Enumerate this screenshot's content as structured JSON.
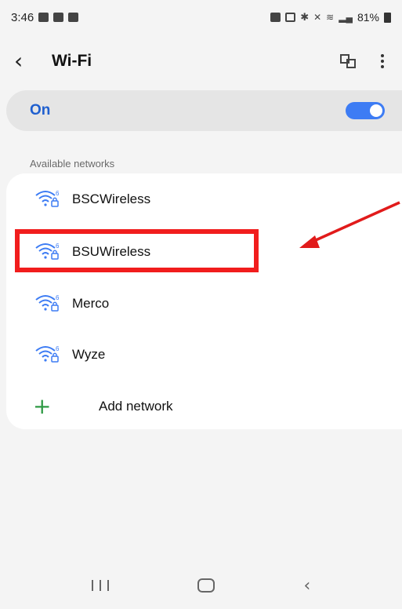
{
  "status_bar": {
    "time": "3:46",
    "battery": "81%",
    "left_icons": [
      "app-b-icon",
      "mail-icon",
      "gallery-icon"
    ],
    "right_icons": [
      "nfc-lock-icon",
      "nfc-icon",
      "bluetooth-icon",
      "mute-icon",
      "wifi-6-status-icon",
      "signal-icon",
      "battery-icon"
    ]
  },
  "app_bar": {
    "title": "Wi-Fi",
    "back_icon": "chevron-left-icon",
    "qr_icon": "qr-scan-icon",
    "more_icon": "more-vertical-icon"
  },
  "wifi_toggle": {
    "label": "On",
    "state": true,
    "accent": "#3d7cf4"
  },
  "networks": {
    "header": "Available networks",
    "items": [
      {
        "name": "BSCWireless",
        "icon": "wifi-6-locked-icon"
      },
      {
        "name": "BSUWireless",
        "icon": "wifi-6-locked-icon"
      },
      {
        "name": "Merco",
        "icon": "wifi-6-locked-icon"
      },
      {
        "name": "Wyze",
        "icon": "wifi-6-locked-icon"
      }
    ],
    "add_label": "Add network",
    "add_icon": "plus-icon"
  },
  "annotation": {
    "highlight_color": "#f11d1d",
    "highlighted_network": "BSUWireless"
  },
  "nav_bar": {
    "icons": [
      "recent-apps-icon",
      "home-icon",
      "back-icon"
    ]
  }
}
